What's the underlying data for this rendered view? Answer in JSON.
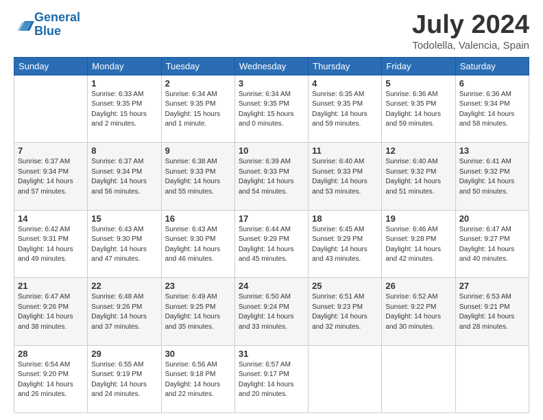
{
  "header": {
    "logo_general": "General",
    "logo_blue": "Blue",
    "month_title": "July 2024",
    "location": "Todolella, Valencia, Spain"
  },
  "days_of_week": [
    "Sunday",
    "Monday",
    "Tuesday",
    "Wednesday",
    "Thursday",
    "Friday",
    "Saturday"
  ],
  "weeks": [
    [
      {
        "day": "",
        "info": ""
      },
      {
        "day": "1",
        "info": "Sunrise: 6:33 AM\nSunset: 9:35 PM\nDaylight: 15 hours\nand 2 minutes."
      },
      {
        "day": "2",
        "info": "Sunrise: 6:34 AM\nSunset: 9:35 PM\nDaylight: 15 hours\nand 1 minute."
      },
      {
        "day": "3",
        "info": "Sunrise: 6:34 AM\nSunset: 9:35 PM\nDaylight: 15 hours\nand 0 minutes."
      },
      {
        "day": "4",
        "info": "Sunrise: 6:35 AM\nSunset: 9:35 PM\nDaylight: 14 hours\nand 59 minutes."
      },
      {
        "day": "5",
        "info": "Sunrise: 6:36 AM\nSunset: 9:35 PM\nDaylight: 14 hours\nand 59 minutes."
      },
      {
        "day": "6",
        "info": "Sunrise: 6:36 AM\nSunset: 9:34 PM\nDaylight: 14 hours\nand 58 minutes."
      }
    ],
    [
      {
        "day": "7",
        "info": "Sunrise: 6:37 AM\nSunset: 9:34 PM\nDaylight: 14 hours\nand 57 minutes."
      },
      {
        "day": "8",
        "info": "Sunrise: 6:37 AM\nSunset: 9:34 PM\nDaylight: 14 hours\nand 56 minutes."
      },
      {
        "day": "9",
        "info": "Sunrise: 6:38 AM\nSunset: 9:33 PM\nDaylight: 14 hours\nand 55 minutes."
      },
      {
        "day": "10",
        "info": "Sunrise: 6:39 AM\nSunset: 9:33 PM\nDaylight: 14 hours\nand 54 minutes."
      },
      {
        "day": "11",
        "info": "Sunrise: 6:40 AM\nSunset: 9:33 PM\nDaylight: 14 hours\nand 53 minutes."
      },
      {
        "day": "12",
        "info": "Sunrise: 6:40 AM\nSunset: 9:32 PM\nDaylight: 14 hours\nand 51 minutes."
      },
      {
        "day": "13",
        "info": "Sunrise: 6:41 AM\nSunset: 9:32 PM\nDaylight: 14 hours\nand 50 minutes."
      }
    ],
    [
      {
        "day": "14",
        "info": "Sunrise: 6:42 AM\nSunset: 9:31 PM\nDaylight: 14 hours\nand 49 minutes."
      },
      {
        "day": "15",
        "info": "Sunrise: 6:43 AM\nSunset: 9:30 PM\nDaylight: 14 hours\nand 47 minutes."
      },
      {
        "day": "16",
        "info": "Sunrise: 6:43 AM\nSunset: 9:30 PM\nDaylight: 14 hours\nand 46 minutes."
      },
      {
        "day": "17",
        "info": "Sunrise: 6:44 AM\nSunset: 9:29 PM\nDaylight: 14 hours\nand 45 minutes."
      },
      {
        "day": "18",
        "info": "Sunrise: 6:45 AM\nSunset: 9:29 PM\nDaylight: 14 hours\nand 43 minutes."
      },
      {
        "day": "19",
        "info": "Sunrise: 6:46 AM\nSunset: 9:28 PM\nDaylight: 14 hours\nand 42 minutes."
      },
      {
        "day": "20",
        "info": "Sunrise: 6:47 AM\nSunset: 9:27 PM\nDaylight: 14 hours\nand 40 minutes."
      }
    ],
    [
      {
        "day": "21",
        "info": "Sunrise: 6:47 AM\nSunset: 9:26 PM\nDaylight: 14 hours\nand 38 minutes."
      },
      {
        "day": "22",
        "info": "Sunrise: 6:48 AM\nSunset: 9:26 PM\nDaylight: 14 hours\nand 37 minutes."
      },
      {
        "day": "23",
        "info": "Sunrise: 6:49 AM\nSunset: 9:25 PM\nDaylight: 14 hours\nand 35 minutes."
      },
      {
        "day": "24",
        "info": "Sunrise: 6:50 AM\nSunset: 9:24 PM\nDaylight: 14 hours\nand 33 minutes."
      },
      {
        "day": "25",
        "info": "Sunrise: 6:51 AM\nSunset: 9:23 PM\nDaylight: 14 hours\nand 32 minutes."
      },
      {
        "day": "26",
        "info": "Sunrise: 6:52 AM\nSunset: 9:22 PM\nDaylight: 14 hours\nand 30 minutes."
      },
      {
        "day": "27",
        "info": "Sunrise: 6:53 AM\nSunset: 9:21 PM\nDaylight: 14 hours\nand 28 minutes."
      }
    ],
    [
      {
        "day": "28",
        "info": "Sunrise: 6:54 AM\nSunset: 9:20 PM\nDaylight: 14 hours\nand 26 minutes."
      },
      {
        "day": "29",
        "info": "Sunrise: 6:55 AM\nSunset: 9:19 PM\nDaylight: 14 hours\nand 24 minutes."
      },
      {
        "day": "30",
        "info": "Sunrise: 6:56 AM\nSunset: 9:18 PM\nDaylight: 14 hours\nand 22 minutes."
      },
      {
        "day": "31",
        "info": "Sunrise: 6:57 AM\nSunset: 9:17 PM\nDaylight: 14 hours\nand 20 minutes."
      },
      {
        "day": "",
        "info": ""
      },
      {
        "day": "",
        "info": ""
      },
      {
        "day": "",
        "info": ""
      }
    ]
  ]
}
